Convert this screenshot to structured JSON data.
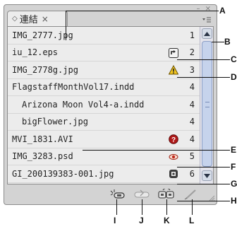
{
  "tab": {
    "label": "連結",
    "close": "×"
  },
  "window_buttons": "– ×",
  "links": [
    {
      "name": "IMG_2777.jpg",
      "page": "1",
      "status": "none"
    },
    {
      "name": "iu_12.eps",
      "page": "2",
      "status": "modified"
    },
    {
      "name": "IMG_2778g.jpg",
      "page": "3",
      "status": "missing-warning"
    },
    {
      "name": "FlagstaffMonthVol17.indd",
      "page": "4",
      "status": "none"
    },
    {
      "name": "Arizona Moon Vol4-a.indd",
      "page": "4",
      "status": "none"
    },
    {
      "name": "bigFlower.jpg",
      "page": "4",
      "status": "none"
    },
    {
      "name": "MVI_1831.AVI",
      "page": "4",
      "status": "missing-link"
    },
    {
      "name": "IMG_3283.psd",
      "page": "5",
      "status": "layer-override"
    },
    {
      "name": "GI_200139383-001.jpg",
      "page": "6",
      "status": "embedded"
    }
  ],
  "callouts": [
    "A",
    "B",
    "C",
    "D",
    "E",
    "F",
    "G",
    "H",
    "I",
    "J",
    "K",
    "L"
  ],
  "toolbar": [
    "relink-icon",
    "go-to-link-icon",
    "update-link-icon",
    "edit-original-icon"
  ]
}
